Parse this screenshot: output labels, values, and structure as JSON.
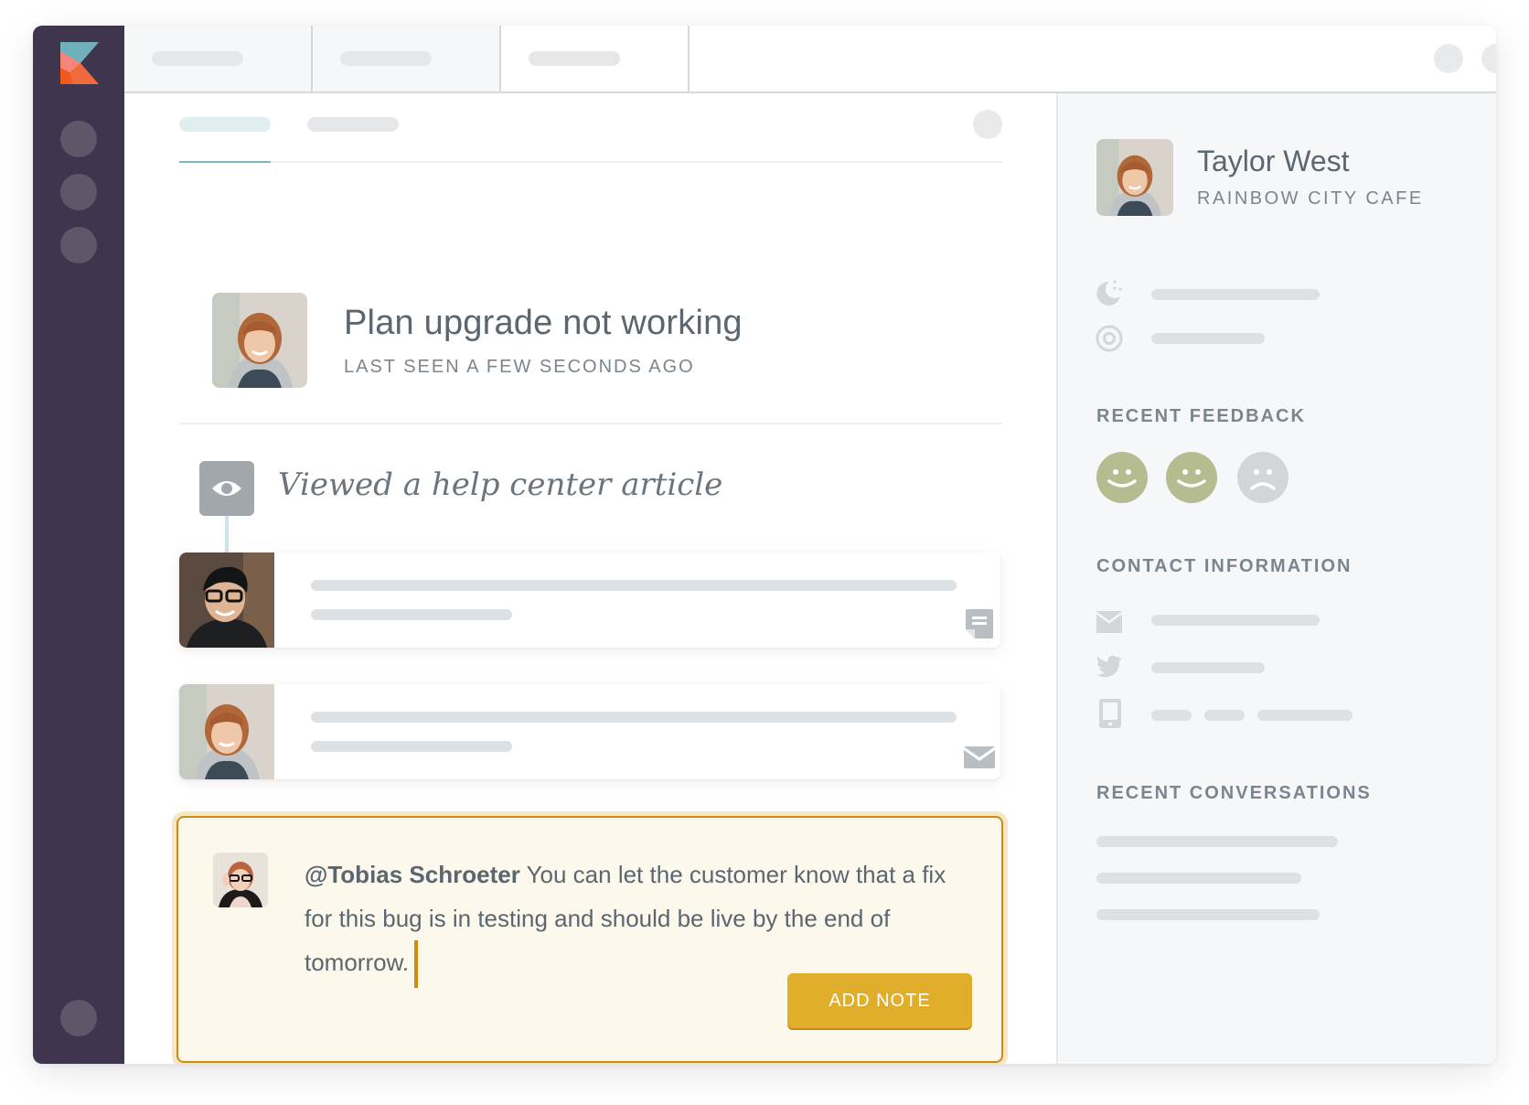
{
  "app": {
    "brand": "Kustomer",
    "sidebar": {
      "nav_items": [
        "nav-item-1",
        "nav-item-2",
        "nav-item-3"
      ],
      "bottom_item": "profile"
    },
    "colors": {
      "sidebar_bg": "#3f354f",
      "accent_teal": "#7fb6bd",
      "note_border": "#cf8a10",
      "button_bg": "#e0ae2b",
      "happy_face": "#b5bc90",
      "sad_face": "#d3d6d9"
    }
  },
  "conversation": {
    "title": "Plan upgrade not working",
    "last_seen": "LAST SEEN A FEW SECONDS AGO",
    "timeline_event": {
      "icon": "eye-icon",
      "text": "Viewed a help center article"
    },
    "messages": [
      {
        "author": "agent",
        "channel_icon": "note-icon"
      },
      {
        "author": "customer",
        "channel_icon": "email-icon"
      }
    ],
    "note": {
      "mention": "@Tobias Schroeter",
      "text": " You can let the customer know that a fix for this bug is in testing and should be live by the end of tomorrow.",
      "button_label": "ADD NOTE"
    }
  },
  "customer": {
    "name": "Taylor West",
    "company": "RAINBOW CITY CAFE",
    "attributes": [
      {
        "icon": "moon-icon"
      },
      {
        "icon": "target-icon"
      }
    ],
    "recent_feedback_heading": "RECENT FEEDBACK",
    "feedback": [
      "positive",
      "positive",
      "negative"
    ],
    "contact_heading": "CONTACT INFORMATION",
    "contacts": [
      {
        "icon": "email-icon"
      },
      {
        "icon": "twitter-icon"
      },
      {
        "icon": "phone-icon"
      }
    ],
    "recent_conversations_heading": "RECENT CONVERSATIONS"
  }
}
